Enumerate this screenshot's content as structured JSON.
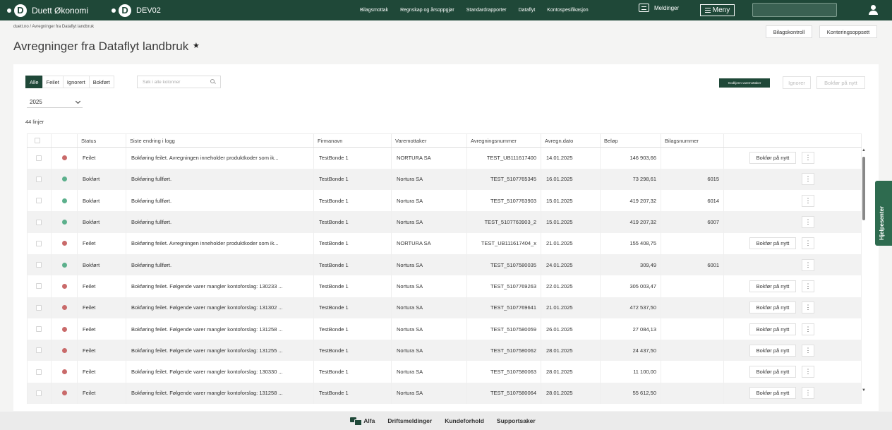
{
  "app": {
    "name": "Duett Økonomi",
    "environment": "DEV02"
  },
  "topnav": {
    "items": [
      "Bilagsmottak",
      "Regnskap og årsoppgjør",
      "Standardrapporter",
      "Dataflyt",
      "Kontospesifikasjon"
    ],
    "messages_label": "Meldinger",
    "menu_label": "Meny"
  },
  "breadcrumb": "duett.no / Avregninger fra Dataflyt landbruk",
  "page": {
    "title": "Avregninger fra Dataflyt landbruk",
    "favorite_glyph": "★"
  },
  "header_buttons": {
    "bilagskontroll": "Bilagskontroll",
    "konteringsoppsett": "Konteringsoppsett"
  },
  "filter_tabs": [
    "Alle",
    "Feilet",
    "Ignorert",
    "Bokført"
  ],
  "active_filter": "Alle",
  "search": {
    "placeholder": "Søk i alle kolonner"
  },
  "year": "2025",
  "row_count": "44 linjer",
  "actions": {
    "approve": "Godkjenn varemottaker",
    "ignore": "Ignorer",
    "rebook": "Bokfør på nytt"
  },
  "table": {
    "headers": [
      "",
      "",
      "Status",
      "Siste endring i logg",
      "Firmanavn",
      "Varemottaker",
      "Avregningsnummer",
      "Avregn.dato",
      "Beløp",
      "Bilagsnummer",
      ""
    ],
    "row_action_label": "Bokfør på nytt",
    "rows": [
      {
        "status": "Feilet",
        "log": "Bokføring feilet. Avregningen inneholder produktkoder som ik...",
        "company": "TestBonde 1",
        "receiver": "NORTURA SA",
        "number": "TEST_UB111617400",
        "date": "14.01.2025",
        "amount": "146 903,66",
        "voucher": "",
        "action": true
      },
      {
        "status": "Bokført",
        "log": "Bokføring fullført.",
        "company": "TestBonde 1",
        "receiver": "Nortura SA",
        "number": "TEST_5107765345",
        "date": "16.01.2025",
        "amount": "73 298,61",
        "voucher": "6015",
        "action": false
      },
      {
        "status": "Bokført",
        "log": "Bokføring fullført.",
        "company": "TestBonde 1",
        "receiver": "Nortura SA",
        "number": "TEST_5107763903",
        "date": "15.01.2025",
        "amount": "419 207,32",
        "voucher": "6014",
        "action": false
      },
      {
        "status": "Bokført",
        "log": "Bokføring fullført.",
        "company": "TestBonde 1",
        "receiver": "Nortura SA",
        "number": "TEST_5107763903_2",
        "date": "15.01.2025",
        "amount": "419 207,32",
        "voucher": "6007",
        "action": false
      },
      {
        "status": "Feilet",
        "log": "Bokføring feilet. Avregningen inneholder produktkoder som ik...",
        "company": "TestBonde 1",
        "receiver": "NORTURA SA",
        "number": "TEST_UB111617404_x",
        "date": "21.01.2025",
        "amount": "155 408,75",
        "voucher": "",
        "action": true
      },
      {
        "status": "Bokført",
        "log": "Bokføring fullført.",
        "company": "TestBonde 1",
        "receiver": "Nortura SA",
        "number": "TEST_5107580035",
        "date": "24.01.2025",
        "amount": "309,49",
        "voucher": "6001",
        "action": false
      },
      {
        "status": "Feilet",
        "log": "Bokføring feilet. Følgende varer mangler kontoforslag: 130233 ...",
        "company": "TestBonde 1",
        "receiver": "Nortura SA",
        "number": "TEST_5107769263",
        "date": "22.01.2025",
        "amount": "305 003,47",
        "voucher": "",
        "action": true
      },
      {
        "status": "Feilet",
        "log": "Bokføring feilet. Følgende varer mangler kontoforslag: 131302 ...",
        "company": "TestBonde 1",
        "receiver": "Nortura SA",
        "number": "TEST_5107769641",
        "date": "21.01.2025",
        "amount": "472 537,50",
        "voucher": "",
        "action": true
      },
      {
        "status": "Feilet",
        "log": "Bokføring feilet. Følgende varer mangler kontoforslag: 131258 ...",
        "company": "TestBonde 1",
        "receiver": "Nortura SA",
        "number": "TEST_5107580059",
        "date": "26.01.2025",
        "amount": "27 084,13",
        "voucher": "",
        "action": true
      },
      {
        "status": "Feilet",
        "log": "Bokføring feilet. Følgende varer mangler kontoforslag: 131255 ...",
        "company": "TestBonde 1",
        "receiver": "Nortura SA",
        "number": "TEST_5107580062",
        "date": "28.01.2025",
        "amount": "24 437,50",
        "voucher": "",
        "action": true
      },
      {
        "status": "Feilet",
        "log": "Bokføring feilet. Følgende varer mangler kontoforslag: 130330 ...",
        "company": "TestBonde 1",
        "receiver": "Nortura SA",
        "number": "TEST_5107580063",
        "date": "28.01.2025",
        "amount": "11 100,00",
        "voucher": "",
        "action": true
      },
      {
        "status": "Feilet",
        "log": "Bokføring feilet. Følgende varer mangler kontoforslag: 131258 ...",
        "company": "TestBonde 1",
        "receiver": "Nortura SA",
        "number": "TEST_5107580064",
        "date": "28.01.2025",
        "amount": "55 612,50",
        "voucher": "",
        "action": true
      }
    ]
  },
  "help_tab": "Hjelpesenter",
  "footer": {
    "items": [
      "Alfa",
      "Driftsmeldinger",
      "Kundeforhold",
      "Supportsaker"
    ]
  },
  "colors": {
    "brand": "#1f4838",
    "failed": "#c96a6a",
    "posted": "#5cb08c",
    "help_tab": "#2e6b4f"
  }
}
